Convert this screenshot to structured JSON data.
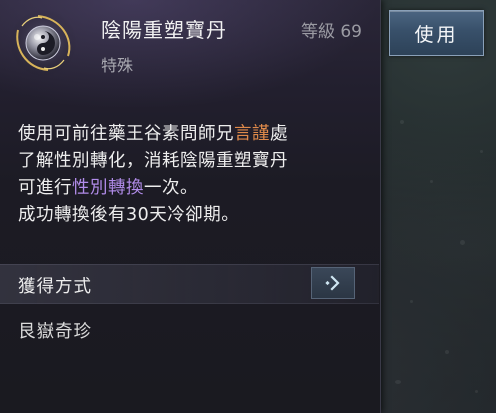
{
  "item": {
    "name": "陰陽重塑寶丹",
    "level": "等級 69",
    "type": "特殊",
    "icon": "yin-yang-pill-icon"
  },
  "description": {
    "line1_a": "使用可前往藥王谷素問師兄",
    "line1_highlight": "言謹",
    "line1_b": "處",
    "line2": "了解性別轉化，消耗陰陽重塑寶丹",
    "line3_a": "可進行",
    "line3_highlight": "性別轉換",
    "line3_b": "一次。",
    "line4": "成功轉換後有30天冷卻期。"
  },
  "acquisition": {
    "label": "獲得方式",
    "button_icon": "arrow-right-icon",
    "source": "艮嶽奇珍"
  },
  "use_button": {
    "label": "使用"
  },
  "colors": {
    "highlight_orange": "#e08a4a",
    "highlight_purple": "#b08be8",
    "button_blue": "#38506a"
  }
}
